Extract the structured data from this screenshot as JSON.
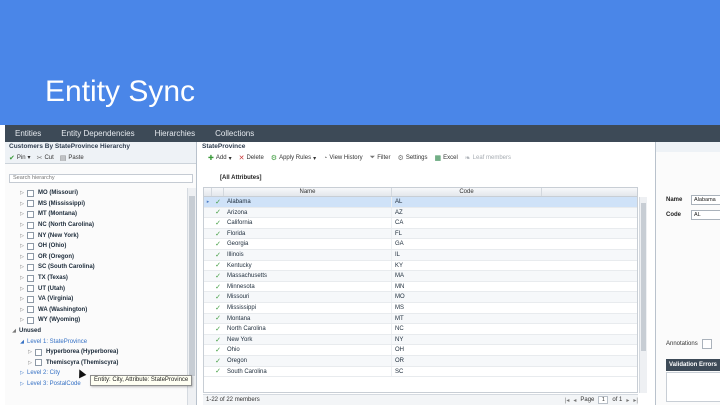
{
  "slide": {
    "title": "Entity Sync"
  },
  "nav": {
    "tabs": [
      "Entities",
      "Entity Dependencies",
      "Hierarchies",
      "Collections"
    ]
  },
  "left": {
    "title": "Customers By StateProvince Hierarchy",
    "toolbar": {
      "pin": "Pin",
      "cut": "Cut",
      "paste": "Paste"
    },
    "search_placeholder": "Search hierarchy",
    "tree": [
      {
        "label": "MO (Missouri)",
        "kind": "member"
      },
      {
        "label": "MS (Mississippi)",
        "kind": "member"
      },
      {
        "label": "MT (Montana)",
        "kind": "member"
      },
      {
        "label": "NC (North Carolina)",
        "kind": "member"
      },
      {
        "label": "NY (New York)",
        "kind": "member"
      },
      {
        "label": "OH (Ohio)",
        "kind": "member"
      },
      {
        "label": "OR (Oregon)",
        "kind": "member"
      },
      {
        "label": "SC (South Carolina)",
        "kind": "member"
      },
      {
        "label": "TX (Texas)",
        "kind": "member"
      },
      {
        "label": "UT (Utah)",
        "kind": "member"
      },
      {
        "label": "VA (Virginia)",
        "kind": "member"
      },
      {
        "label": "WA (Washington)",
        "kind": "member"
      },
      {
        "label": "WY (Wyoming)",
        "kind": "member"
      },
      {
        "label": "Unused",
        "kind": "group"
      },
      {
        "label": "Level 1: StateProvince",
        "kind": "level"
      },
      {
        "label": "Hyperborea (Hyperborea)",
        "kind": "child"
      },
      {
        "label": "Themiscyra (Themiscyra)",
        "kind": "child"
      },
      {
        "label": "Level 2: City",
        "kind": "level"
      },
      {
        "label": "Level 3: PostalCode",
        "kind": "level"
      }
    ],
    "tooltip": "Entity: City, Attribute: StateProvince"
  },
  "mid": {
    "title": "StateProvince",
    "toolbar": {
      "add": "Add",
      "delete": "Delete",
      "apply_rules": "Apply Rules",
      "view_history": "View History",
      "filter": "Filter",
      "settings": "Settings",
      "excel": "Excel",
      "leaf_members": "Leaf members"
    },
    "attributes_label": "[All Attributes]",
    "columns": {
      "name": "Name",
      "code": "Code"
    },
    "rows": [
      {
        "name": "Alabama",
        "code": "AL"
      },
      {
        "name": "Arizona",
        "code": "AZ"
      },
      {
        "name": "California",
        "code": "CA"
      },
      {
        "name": "Florida",
        "code": "FL"
      },
      {
        "name": "Georgia",
        "code": "GA"
      },
      {
        "name": "Illinois",
        "code": "IL"
      },
      {
        "name": "Kentucky",
        "code": "KY"
      },
      {
        "name": "Massachusetts",
        "code": "MA"
      },
      {
        "name": "Minnesota",
        "code": "MN"
      },
      {
        "name": "Missouri",
        "code": "MO"
      },
      {
        "name": "Mississippi",
        "code": "MS"
      },
      {
        "name": "Montana",
        "code": "MT"
      },
      {
        "name": "North Carolina",
        "code": "NC"
      },
      {
        "name": "New York",
        "code": "NY"
      },
      {
        "name": "Ohio",
        "code": "OH"
      },
      {
        "name": "Oregon",
        "code": "OR"
      },
      {
        "name": "South Carolina",
        "code": "SC"
      }
    ],
    "pager": {
      "summary": "1-22 of 22 members",
      "page_label": "Page",
      "page_value": "1",
      "of_label": "of 1"
    }
  },
  "right": {
    "name_label": "Name",
    "name_value": "Alabama",
    "code_label": "Code",
    "code_value": "AL",
    "annotations_label": "Annotations",
    "validation_label": "Validation Errors"
  }
}
